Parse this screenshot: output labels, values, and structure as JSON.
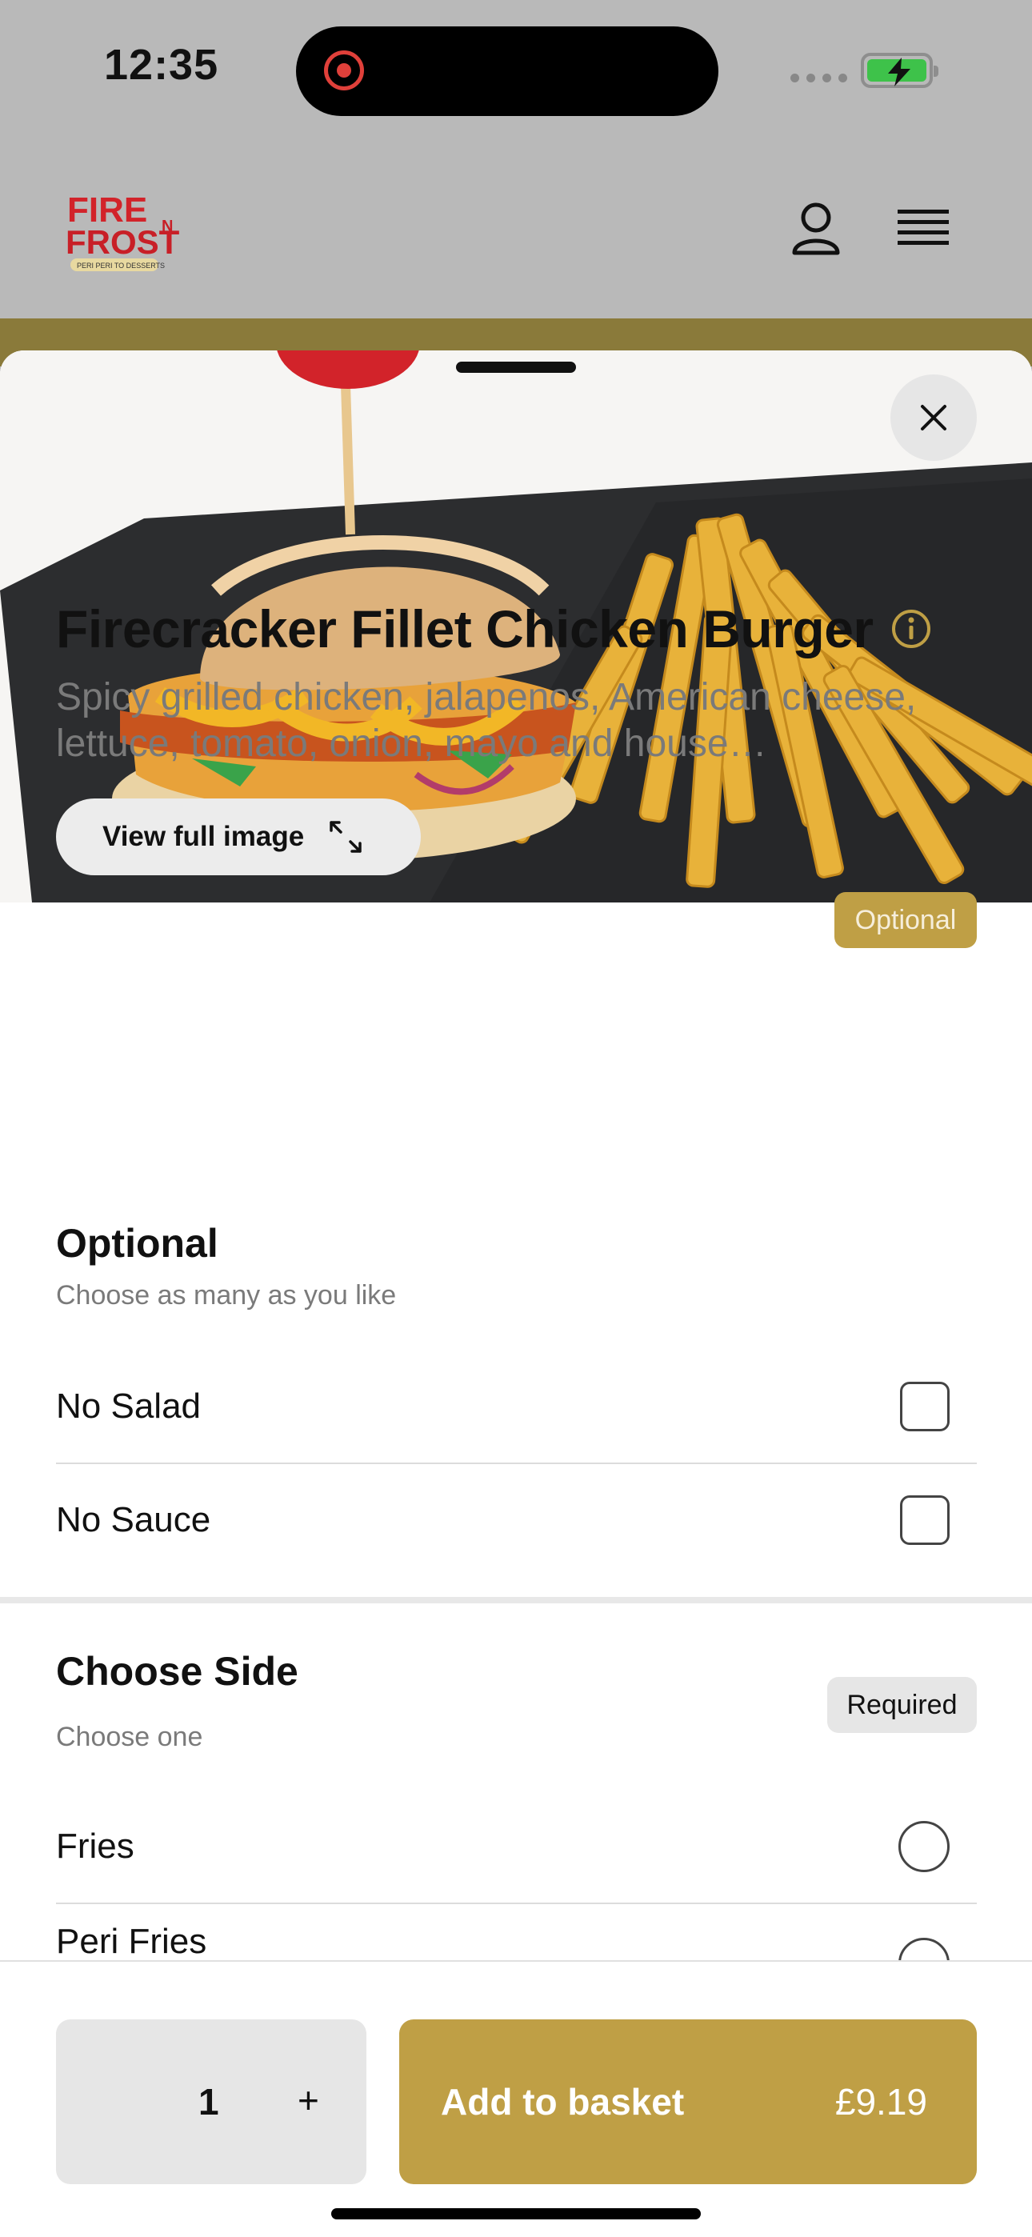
{
  "status_bar": {
    "time": "12:35"
  },
  "colors": {
    "brand_gold": "#bf9f45",
    "logo_red": "#d2232a",
    "badge_required_bg": "#e6e6e6"
  },
  "header": {
    "logo_icon": "fire-n-frost-logo",
    "account_icon": "user-icon",
    "menu_icon": "hamburger-menu-icon"
  },
  "modal": {
    "view_full_image_label": "View full image",
    "item": {
      "title": "Firecracker Fillet Chicken Burger",
      "description": "Spicy grilled chicken, jalapenos, American cheese, lettuce, tomato, onion, mayo and house…"
    },
    "sections": [
      {
        "title": "Optional",
        "subtitle": "Choose as many as you like",
        "badge": "Optional",
        "options": [
          {
            "label": "No Salad",
            "checked": false
          },
          {
            "label": "No Sauce",
            "checked": false
          }
        ]
      },
      {
        "title": "Choose Side",
        "subtitle": "Choose one",
        "badge": "Required",
        "options": [
          {
            "label": "Fries",
            "selected": false
          },
          {
            "label": "Peri Fries",
            "selected": false
          }
        ]
      }
    ]
  },
  "footer": {
    "quantity": "1",
    "plus": "+",
    "add_label": "Add to basket",
    "price": "£9.19"
  }
}
